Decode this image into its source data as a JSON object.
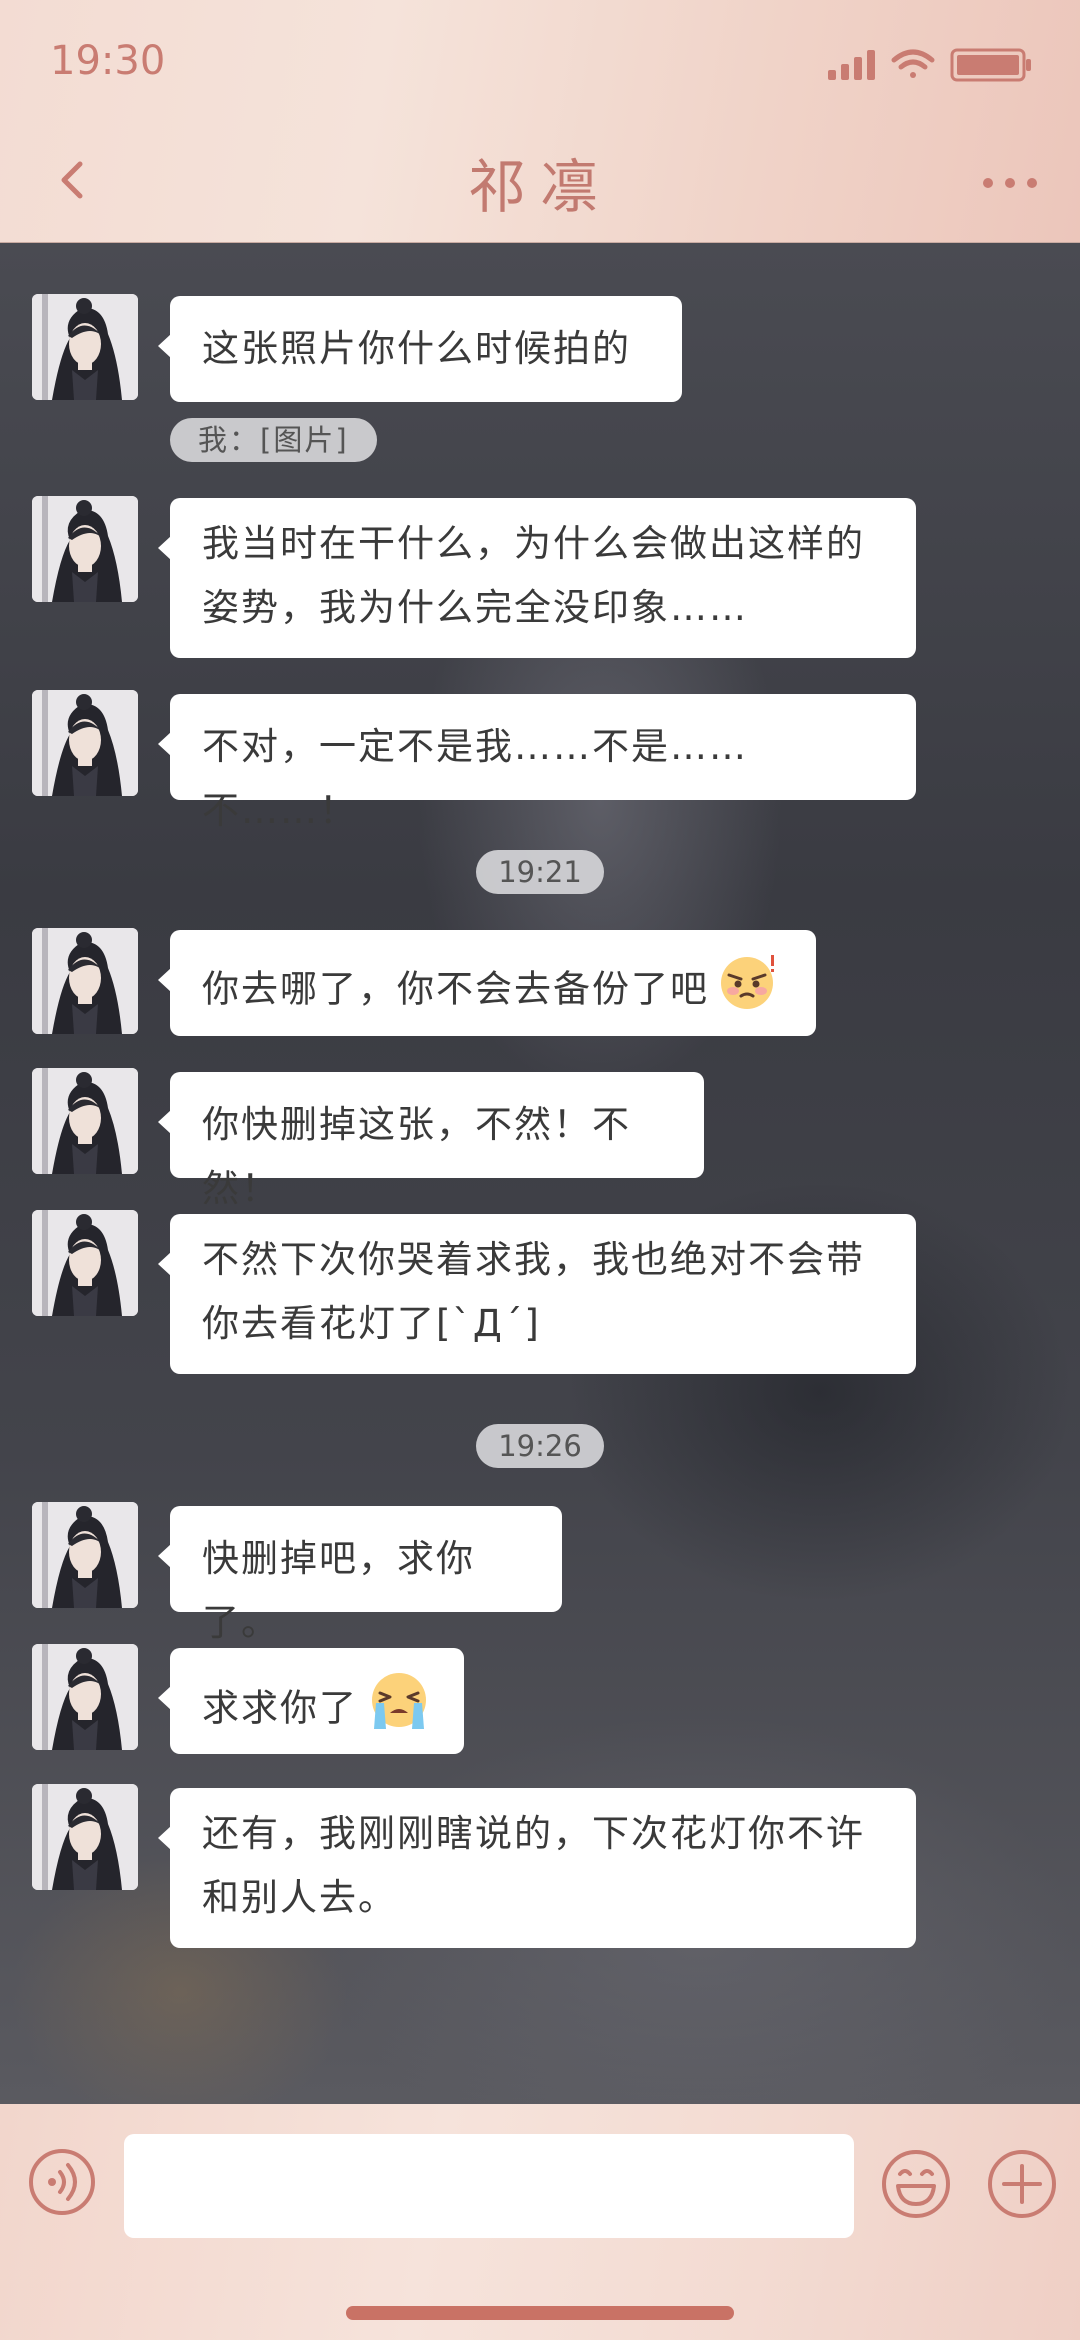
{
  "status_bar": {
    "time": "19:30"
  },
  "header": {
    "title": "祁凛"
  },
  "colors": {
    "accent": "#c97c72",
    "bubble": "#ffffff",
    "header_bg": "#f3dcd3"
  },
  "messages": [
    {
      "type": "text",
      "sender": "祁凛",
      "lines": [
        "这张照片你什么时候拍的"
      ]
    },
    {
      "type": "quote",
      "text": "我：[图片]"
    },
    {
      "type": "text",
      "sender": "祁凛",
      "lines": [
        "我当时在干什么，为什么会做出这样的",
        "姿势，我为什么完全没印象……"
      ]
    },
    {
      "type": "text",
      "sender": "祁凛",
      "lines": [
        "不对，一定不是我……不是……不……！"
      ]
    },
    {
      "type": "time",
      "text": "19:21"
    },
    {
      "type": "text",
      "sender": "祁凛",
      "lines": [
        "你去哪了，你不会去备份了吧"
      ],
      "emoji": "angry-face-emoji"
    },
    {
      "type": "text",
      "sender": "祁凛",
      "lines": [
        "你快删掉这张，不然！不然！"
      ]
    },
    {
      "type": "text",
      "sender": "祁凛",
      "lines": [
        "不然下次你哭着求我，我也绝对不会带",
        "你去看花灯了[`Д´]"
      ]
    },
    {
      "type": "time",
      "text": "19:26"
    },
    {
      "type": "text",
      "sender": "祁凛",
      "lines": [
        "快删掉吧，求你了。"
      ]
    },
    {
      "type": "text",
      "sender": "祁凛",
      "lines": [
        "求求你了"
      ],
      "emoji": "crying-face-emoji"
    },
    {
      "type": "text",
      "sender": "祁凛",
      "lines": [
        "还有，我刚刚瞎说的，下次花灯你不许",
        "和别人去。"
      ]
    }
  ],
  "input": {
    "value": "",
    "placeholder": ""
  },
  "icons": {
    "back": "chevron-left-icon",
    "more": "more-dots-icon",
    "voice": "voice-icon",
    "emoji": "smiley-icon",
    "plus": "plus-icon"
  }
}
